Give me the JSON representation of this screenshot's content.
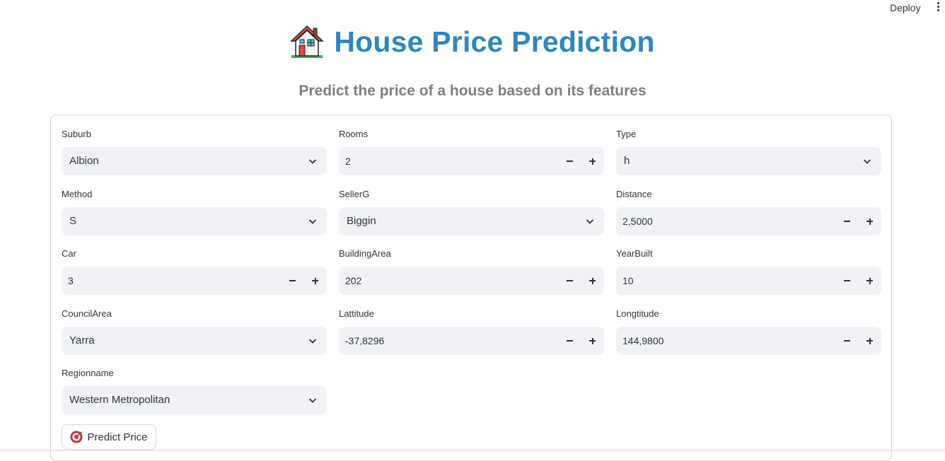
{
  "topbar": {
    "deploy_label": "Deploy",
    "menu_icon": "kebab-menu-icon"
  },
  "header": {
    "icon": "house-icon",
    "title": "House Price Prediction",
    "subtitle": "Predict the price of a house based on its features",
    "title_color": "#2e86c1"
  },
  "form": {
    "suburb": {
      "label": "Suburb",
      "value": "Albion"
    },
    "rooms": {
      "label": "Rooms",
      "value": "2"
    },
    "type": {
      "label": "Type",
      "value": "h"
    },
    "method": {
      "label": "Method",
      "value": "S"
    },
    "sellerg": {
      "label": "SellerG",
      "value": "Biggin"
    },
    "distance": {
      "label": "Distance",
      "value": "2,5000"
    },
    "car": {
      "label": "Car",
      "value": "3"
    },
    "building_area": {
      "label": "BuildingArea",
      "value": "202"
    },
    "year_built": {
      "label": "YearBuilt",
      "value": "10"
    },
    "council_area": {
      "label": "CouncilArea",
      "value": "Yarra"
    },
    "lattitude": {
      "label": "Lattitude",
      "value": "-37,8296"
    },
    "longtitude": {
      "label": "Longtitude",
      "value": "144,9800"
    },
    "regionname": {
      "label": "Regionname",
      "value": "Western Metropolitan"
    }
  },
  "predict_button": {
    "label": "Predict Price",
    "icon": "target-icon"
  }
}
